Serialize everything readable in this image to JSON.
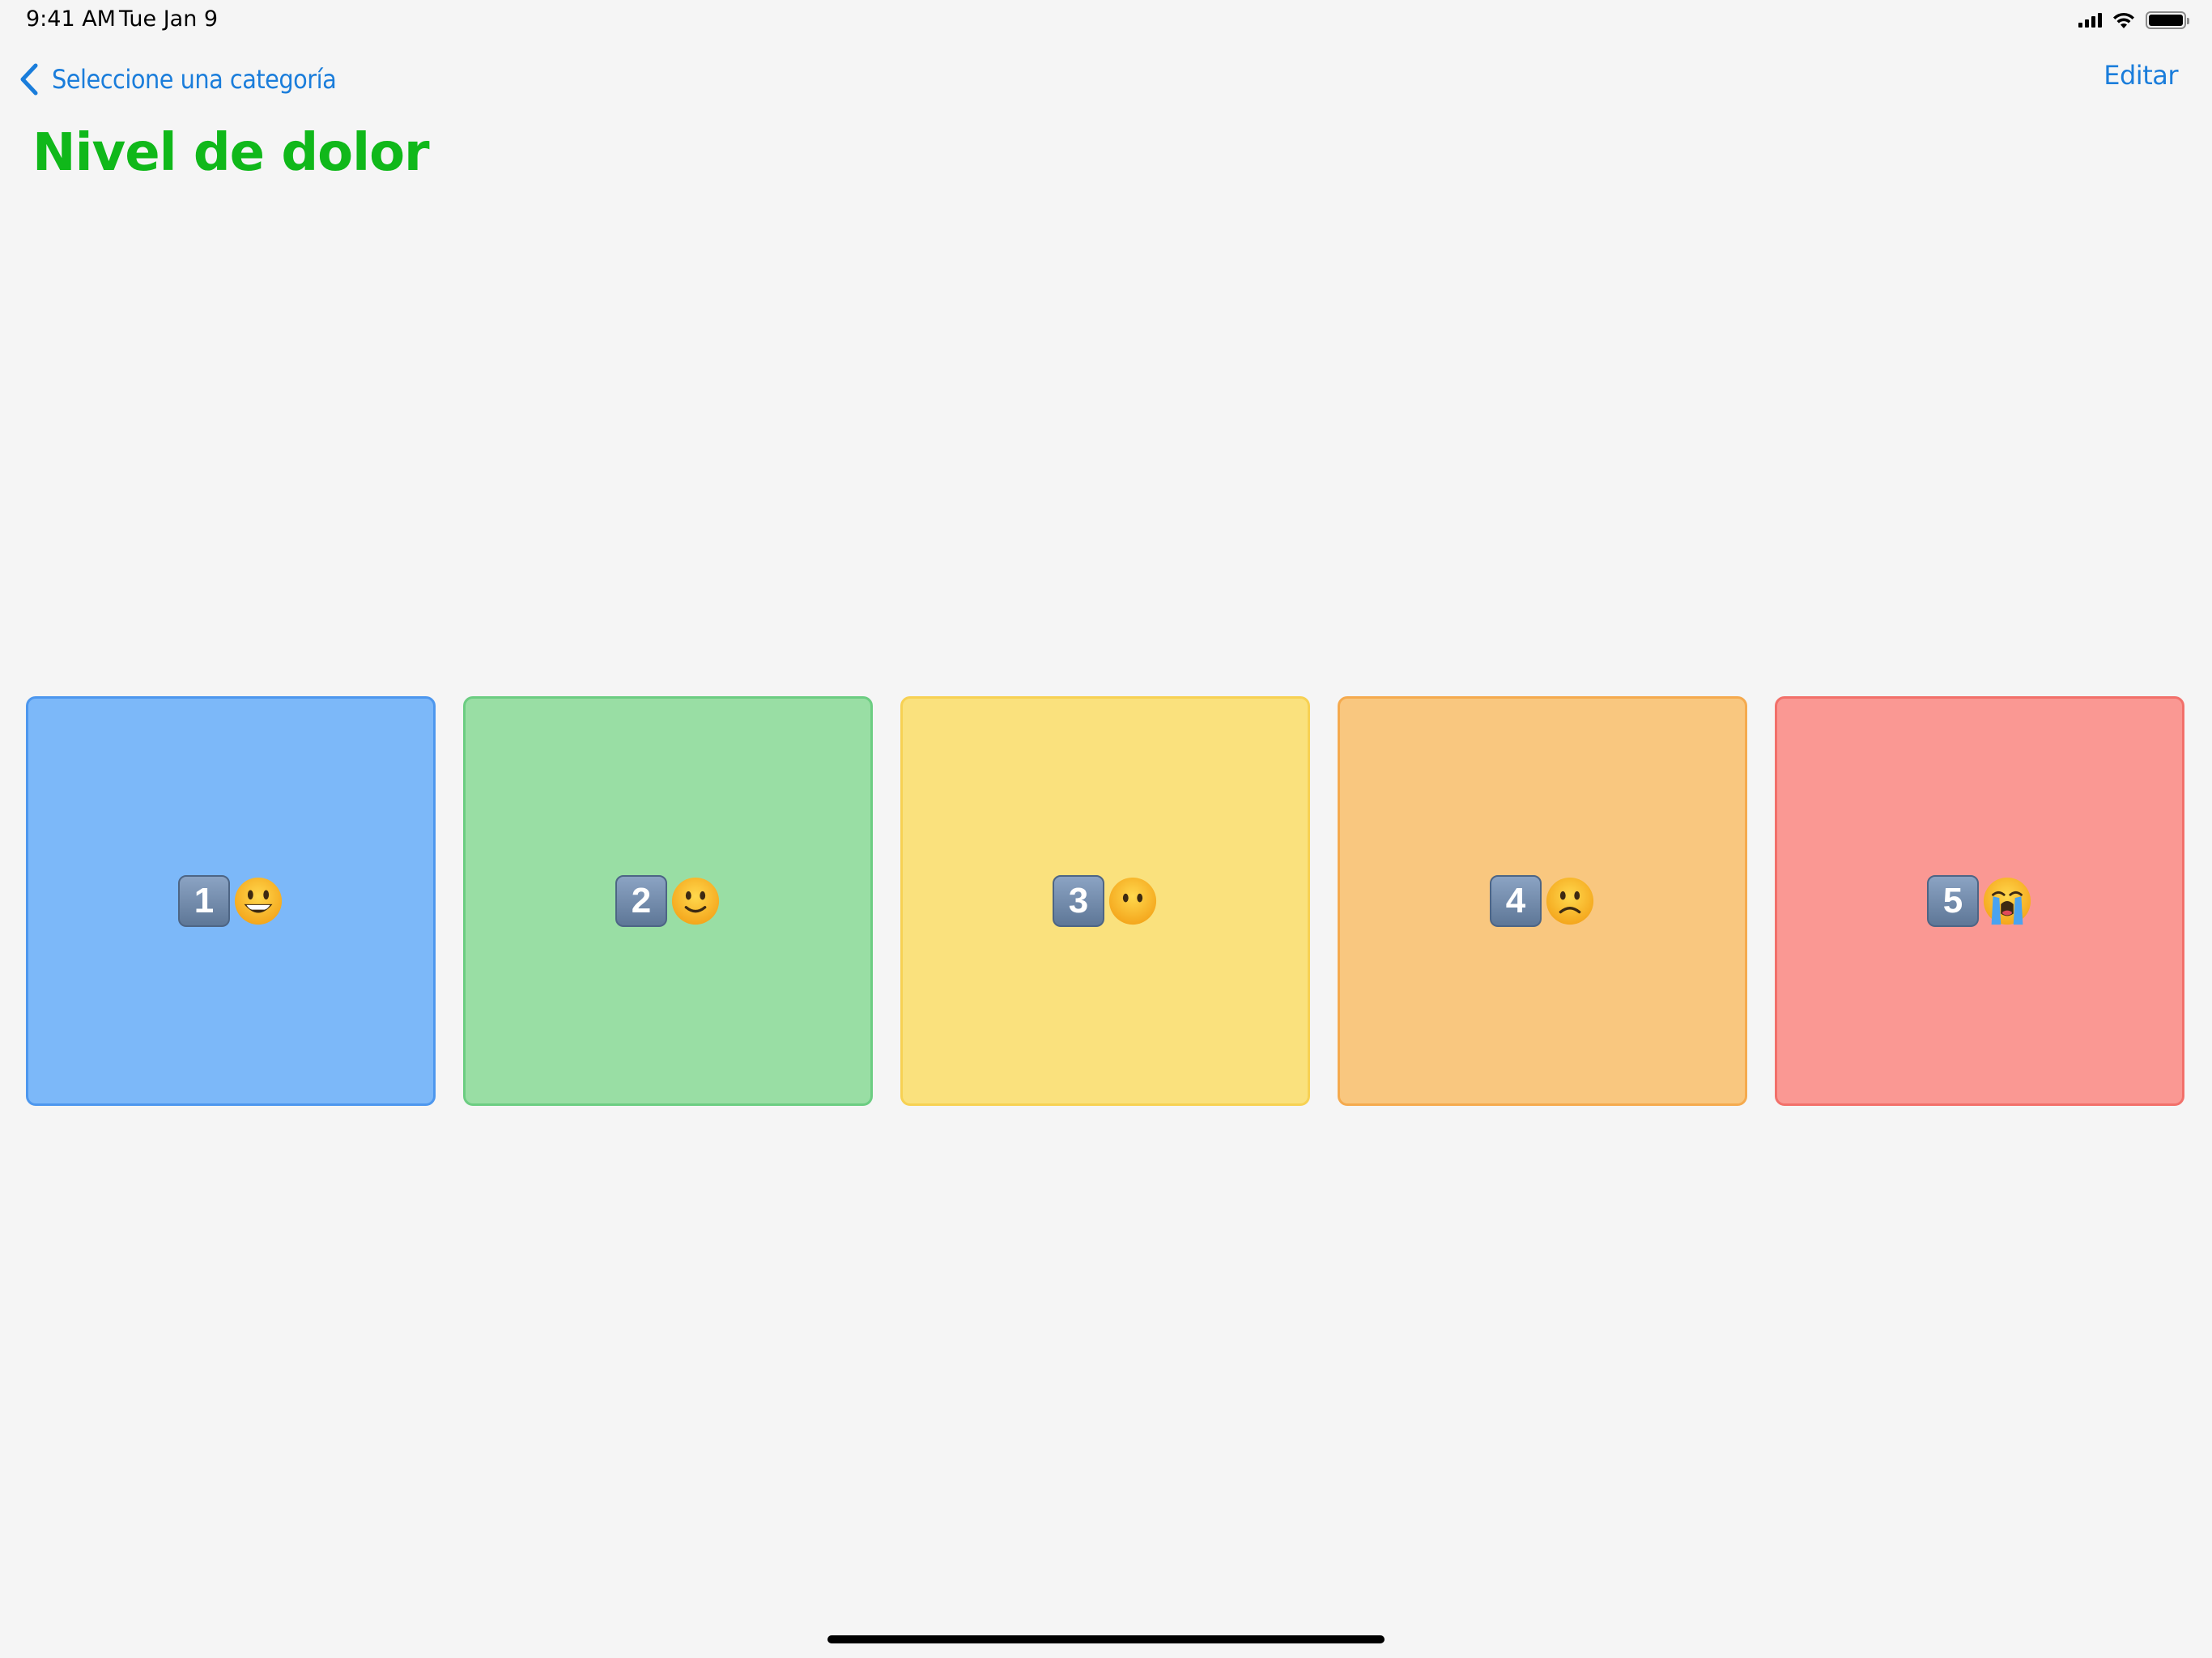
{
  "status_bar": {
    "time": "9:41 AM",
    "date": "Tue Jan 9",
    "signal_icon": "cellular-signal-icon",
    "wifi_icon": "wifi-icon",
    "battery_icon": "battery-icon"
  },
  "nav": {
    "back_label": "Seleccione una categoría",
    "back_icon": "chevron-left-icon",
    "edit_label": "Editar",
    "accent_color": "#1a7ddb"
  },
  "title": {
    "text": "Nivel de dolor",
    "color": "#10b81a"
  },
  "tiles": [
    {
      "number": "1",
      "emoji": "grinning-face-icon",
      "fill": "#7cb8f9",
      "border": "#4d97ee"
    },
    {
      "number": "2",
      "emoji": "slightly-smiling-face-icon",
      "fill": "#99dea4",
      "border": "#6ccd82"
    },
    {
      "number": "3",
      "emoji": "face-without-mouth-icon",
      "fill": "#fae17d",
      "border": "#f7d153"
    },
    {
      "number": "4",
      "emoji": "slightly-frowning-face-icon",
      "fill": "#f9c77f",
      "border": "#f5aa4e"
    },
    {
      "number": "5",
      "emoji": "loudly-crying-face-icon",
      "fill": "#fa9893",
      "border": "#f2706a"
    }
  ]
}
